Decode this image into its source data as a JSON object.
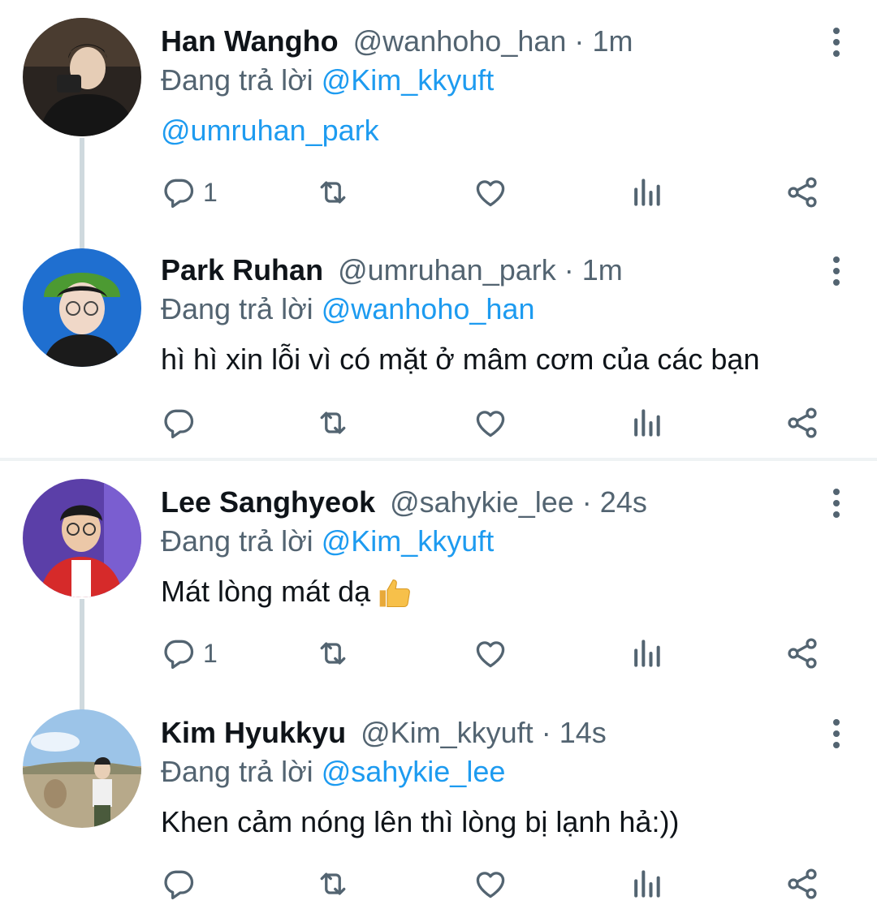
{
  "replying_prefix": "Đang trả lời",
  "tweets": [
    {
      "name": "Han Wangho",
      "handle": "@wanhoho_han",
      "time": "1m",
      "reply_to": "@Kim_kkyuft",
      "text": "@umruhan_park",
      "reply_count": "1"
    },
    {
      "name": "Park Ruhan",
      "handle": "@umruhan_park",
      "time": "1m",
      "reply_to": "@wanhoho_han",
      "text": "hì hì xin lỗi vì có mặt ở mâm cơm của các bạn",
      "reply_count": ""
    },
    {
      "name": "Lee Sanghyeok",
      "handle": "@sahykie_lee",
      "time": "24s",
      "reply_to": "@Kim_kkyuft",
      "text": "Mát lòng mát dạ",
      "emoji": "thumbs-up",
      "reply_count": "1"
    },
    {
      "name": "Kim Hyukkyu",
      "handle": "@Kim_kkyuft",
      "time": "14s",
      "reply_to": "@sahykie_lee",
      "text": "Khen cảm nóng lên thì lòng bị lạnh hả:))",
      "reply_count": ""
    }
  ],
  "separator": "·",
  "colors": {
    "accent": "#1d9bf0",
    "muted": "#536471",
    "thread_line": "#cfd9de",
    "divider": "#eff3f4"
  },
  "icons": [
    "reply-icon",
    "retweet-icon",
    "like-icon",
    "views-icon",
    "share-icon",
    "more-icon"
  ]
}
